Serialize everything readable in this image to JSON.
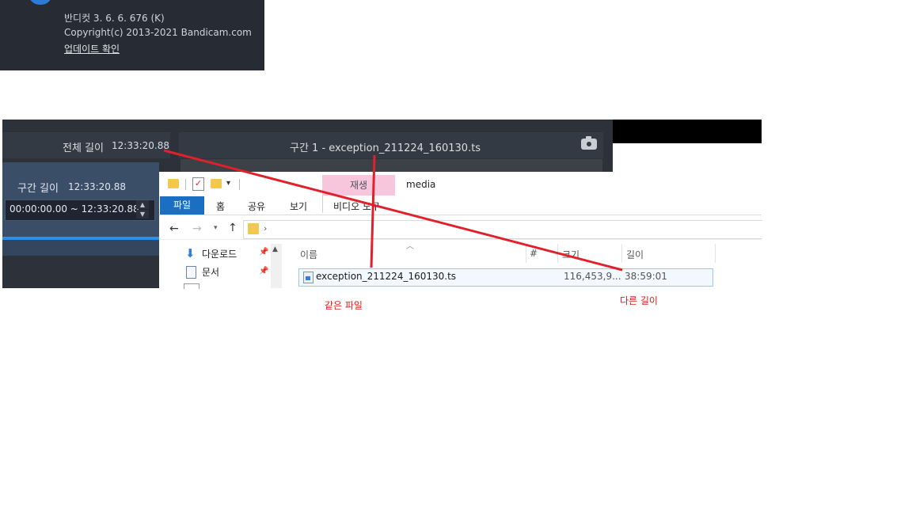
{
  "about": {
    "version": "반디컷 3. 6. 6. 676 (K)",
    "copyright": "Copyright(c) 2013-2021 Bandicam.com",
    "update_link": "업데이트 확인"
  },
  "editor": {
    "total_length_label": "전체 길이",
    "total_length_value": "12:33:20.88",
    "segment_title": "구간 1 - exception_211224_160130.ts",
    "segment_length_label": "구간 길이",
    "segment_length_value": "12:33:20.88",
    "range": "00:00:00.00 ~ 12:33:20.88"
  },
  "explorer": {
    "context_tab": "재생",
    "window_title": "media",
    "tabs": {
      "file": "파일",
      "home": "홈",
      "share": "공유",
      "view": "보기",
      "video": "비디오 도구"
    },
    "nav_items": [
      {
        "label": "다운로드",
        "icon": "download-icon"
      },
      {
        "label": "문서",
        "icon": "document-icon"
      }
    ],
    "columns": {
      "name": "이름",
      "num": "#",
      "size": "크기",
      "length": "길이"
    },
    "file": {
      "name": "exception_211224_160130.ts",
      "size": "116,453,9...",
      "length": "38:59:01"
    }
  },
  "annotations": {
    "same_file": "같은 파일",
    "different_length": "다른 길이",
    "color": "#e0202a"
  }
}
